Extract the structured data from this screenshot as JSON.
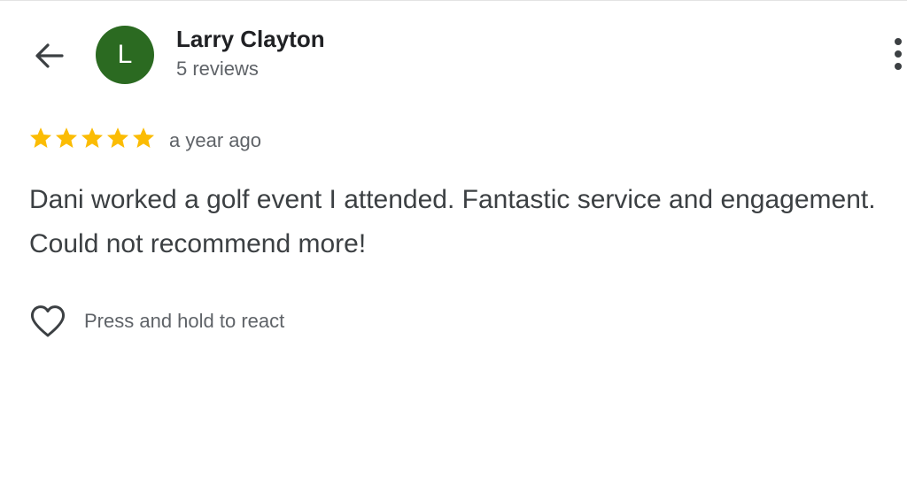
{
  "header": {
    "back_icon": "arrow-left-icon",
    "avatar_letter": "L",
    "avatar_color": "#2b6a21",
    "reviewer_name": "Larry Clayton",
    "review_count": "5 reviews",
    "more_icon": "more-vertical-icon"
  },
  "review": {
    "rating": 5,
    "rating_max": 5,
    "star_color": "#fbbc04",
    "time": "a year ago",
    "text": "Dani worked a golf event I attended. Fantastic service and engagement. Could not recommend more!"
  },
  "reaction": {
    "icon": "heart-outline-icon",
    "label": "Press and hold to react"
  }
}
